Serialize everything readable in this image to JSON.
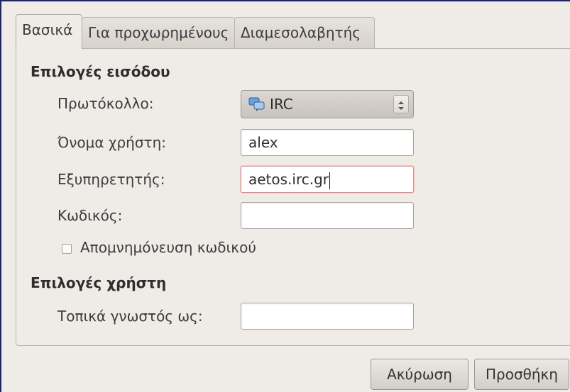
{
  "tabs": [
    {
      "label": "Βασικά",
      "active": true
    },
    {
      "label": "Για προχωρημένους",
      "active": false
    },
    {
      "label": "Διαμεσολαβητής",
      "active": false
    }
  ],
  "login": {
    "section_title": "Επιλογές εισόδου",
    "protocol_label": "Πρωτόκολλο:",
    "protocol_value": "IRC",
    "protocol_icon": "chat-bubbles-icon",
    "username_label": "Όνομα χρήστη:",
    "username_value": "alex",
    "server_label": "Εξυπηρετητής:",
    "server_value": "aetos.irc.gr",
    "password_label": "Κωδικός:",
    "password_value": "",
    "remember_password_label": "Απομνημόνευση κωδικού",
    "remember_password_checked": false
  },
  "user": {
    "section_title": "Επιλογές χρήστη",
    "local_alias_label": "Τοπικά γνωστός ως:",
    "local_alias_value": ""
  },
  "actions": {
    "cancel_label": "Ακύρωση",
    "add_label": "Προσθήκη"
  },
  "colors": {
    "window_bg": "#efebe7",
    "frame_border": "#1a237e",
    "focus_border": "#e08a8a"
  }
}
